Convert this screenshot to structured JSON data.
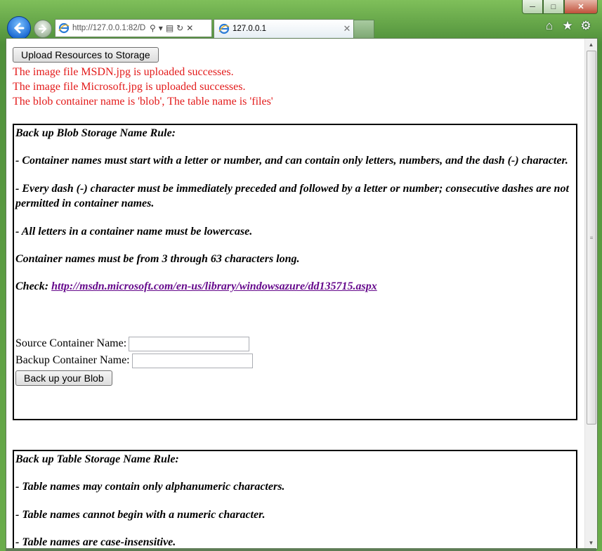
{
  "window": {
    "caption_buttons": [
      "minimize-icon",
      "maximize-icon",
      "close-icon"
    ]
  },
  "nav": {
    "address_text": "http://127.0.0.1:82/D",
    "address_tools": [
      "search-icon",
      "dropdown-icon",
      "compat-icon",
      "refresh-icon",
      "stop-icon"
    ],
    "tab_title": "127.0.0.1",
    "tab_close": "✕",
    "right_tools": [
      "home-icon",
      "favorites-icon",
      "tools-icon"
    ]
  },
  "page": {
    "upload_button": "Upload Resources to Storage",
    "messages": [
      "The image file MSDN.jpg is uploaded successes.",
      "The image file Microsoft.jpg is uploaded successes.",
      "The blob container name is 'blob', The table name is 'files'"
    ],
    "blob_section": {
      "title": "Back up Blob Storage Name Rule:",
      "rules": [
        "- Container names must start with a letter or number, and can contain only letters, numbers, and the dash (-) character.",
        "- Every dash (-) character must be immediately preceded and followed by a letter or number; consecutive dashes are not permitted in container names.",
        "- All letters in a container name must be lowercase.",
        "Container names must be from 3 through 63 characters long."
      ],
      "check_label": "Check:",
      "check_link": "http://msdn.microsoft.com/en-us/library/windowsazure/dd135715.aspx",
      "source_label": "Source Container Name:",
      "source_value": "",
      "backup_label": "Backup Container Name:",
      "backup_value": "",
      "backup_button": "Back up your Blob"
    },
    "table_section": {
      "title": "Back up Table Storage Name Rule:",
      "rules": [
        "- Table names may contain only alphanumeric characters.",
        "- Table names cannot begin with a numeric character.",
        "- Table names are case-insensitive."
      ]
    }
  }
}
